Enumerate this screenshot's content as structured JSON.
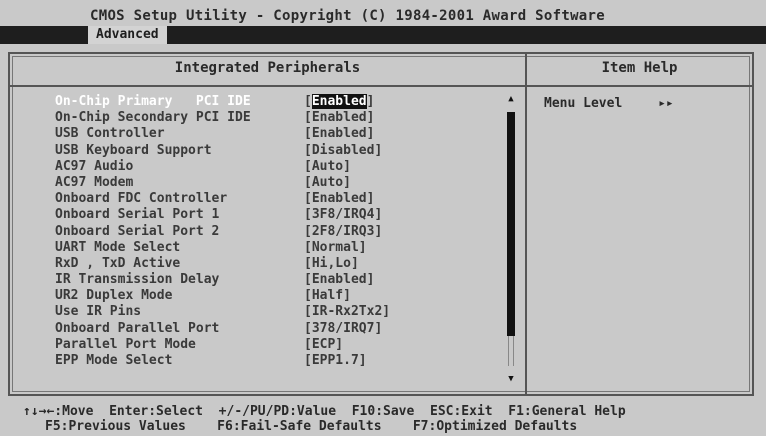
{
  "window": {
    "title": "CMOS Setup Utility - Copyright (C) 1984-2001 Award Software",
    "tab": "Advanced"
  },
  "panel": {
    "title": "Integrated Peripherals",
    "help_title": "Item Help",
    "help_menu_level": "Menu Level",
    "help_arrows": "▸▸"
  },
  "items": [
    {
      "label": "On-Chip Primary   PCI IDE",
      "value_pre": "[",
      "value": "Enabled",
      "value_post": "]",
      "active": true
    },
    {
      "label": "On-Chip Secondary PCI IDE",
      "value": "[Enabled]"
    },
    {
      "label": "USB Controller",
      "value": "[Enabled]"
    },
    {
      "label": "USB Keyboard Support",
      "value": "[Disabled]"
    },
    {
      "label": "AC97 Audio",
      "value": "[Auto]"
    },
    {
      "label": "AC97 Modem",
      "value": "[Auto]"
    },
    {
      "label": "Onboard FDC Controller",
      "value": "[Enabled]"
    },
    {
      "label": "Onboard Serial Port 1",
      "value": "[3F8/IRQ4]"
    },
    {
      "label": "Onboard Serial Port 2",
      "value": "[2F8/IRQ3]"
    },
    {
      "label": "UART Mode Select",
      "value": "[Normal]"
    },
    {
      "label": "RxD , TxD Active",
      "value": "[Hi,Lo]"
    },
    {
      "label": "IR Transmission Delay",
      "value": "[Enabled]"
    },
    {
      "label": "UR2 Duplex Mode",
      "value": "[Half]"
    },
    {
      "label": "Use IR Pins",
      "value": "[IR-Rx2Tx2]"
    },
    {
      "label": "Onboard Parallel Port",
      "value": "[378/IRQ7]"
    },
    {
      "label": "Parallel Port Mode",
      "value": "[ECP]"
    },
    {
      "label": "EPP Mode Select",
      "value": "[EPP1.7]"
    }
  ],
  "scroll": {
    "up": "▲",
    "down": "▼"
  },
  "footer": {
    "line1": "↑↓→←:Move  Enter:Select  +/-/PU/PD:Value  F10:Save  ESC:Exit  F1:General Help",
    "line2": "F5:Previous Values    F6:Fail-Safe Defaults    F7:Optimized Defaults"
  }
}
